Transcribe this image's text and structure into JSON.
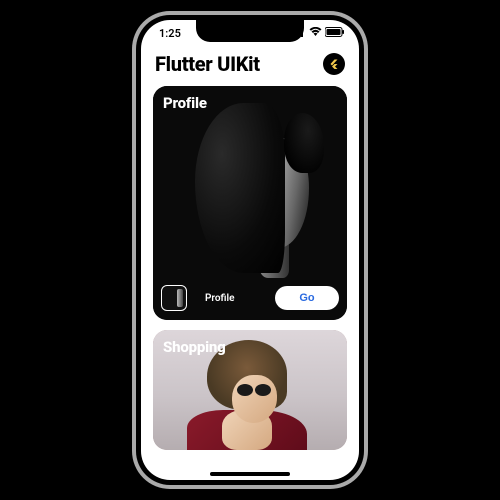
{
  "status": {
    "time": "1:25"
  },
  "header": {
    "title": "Flutter UIKit"
  },
  "cards": {
    "profile": {
      "heading": "Profile",
      "footer_label": "Profile",
      "go_label": "Go"
    },
    "shopping": {
      "heading": "Shopping"
    }
  }
}
